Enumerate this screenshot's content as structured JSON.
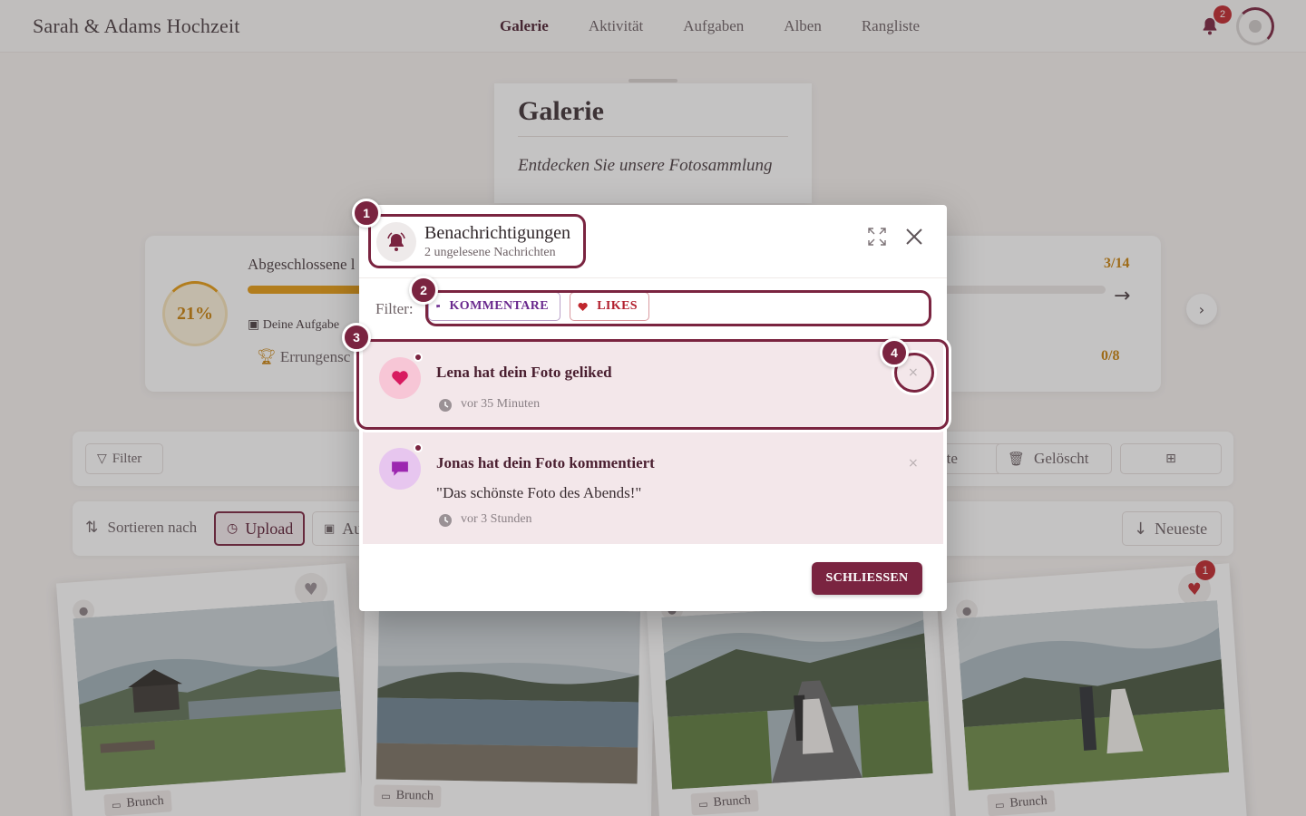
{
  "header": {
    "brand": "Sarah & Adams Hochzeit",
    "nav": [
      "Galerie",
      "Aktivität",
      "Aufgaben",
      "Alben",
      "Rangliste"
    ],
    "active_nav": "Galerie",
    "notification_count": "2"
  },
  "page": {
    "title": "Galerie",
    "subtitle": "Entdecken Sie unsere Fotosammlung"
  },
  "stats": {
    "percent": "21%",
    "progress_fraction": 0.21,
    "completed_label": "Abgeschlossene l",
    "tasks_label": "Deine Aufgabe",
    "achievements_label": "Errungensc",
    "count_tasks": "3/14",
    "count_achievements": "0/8"
  },
  "filterbar": {
    "filter_label": "Filter",
    "partial_label": "rte",
    "deleted_label": "Gelöscht"
  },
  "sortbar": {
    "sort_label": "Sortieren nach",
    "upload_label": "Upload",
    "partial_label": "Au",
    "newest_label": "Neueste"
  },
  "photos": [
    {
      "album": "Brunch",
      "liked": false
    },
    {
      "album": "Brunch",
      "liked": false
    },
    {
      "album": "Brunch",
      "liked": false
    },
    {
      "album": "Brunch",
      "liked": true,
      "like_badge": "1"
    }
  ],
  "modal": {
    "title": "Benachrichtigungen",
    "subtitle": "2 ungelesene Nachrichten",
    "filter_label": "Filter:",
    "chips": {
      "comments": "KOMMENTARE",
      "likes": "LIKES"
    },
    "notifications": [
      {
        "type": "like",
        "title": "Lena hat dein Foto geliked",
        "time": "vor 35 Minuten",
        "unread": true
      },
      {
        "type": "comment",
        "title": "Jonas hat dein Foto kommentiert",
        "quote": "\"Das schönste Foto des Abends!\"",
        "time": "vor 3 Stunden",
        "unread": true
      }
    ],
    "close_button": "SCHLIESSEN"
  },
  "tutorial_steps": [
    "1",
    "2",
    "3",
    "4"
  ],
  "colors": {
    "brand": "#7a2440",
    "accent_progress": "#e69b12",
    "badge": "#c0272d",
    "comment_chip": "#6a2a8e",
    "like_chip": "#b21f2d"
  },
  "icons": [
    "bell-icon",
    "user-avatar-icon",
    "trophy-icon",
    "image-icon",
    "arrow-right-icon",
    "chevron-right-icon",
    "filter-icon",
    "trash-icon",
    "grid-icon",
    "sort-icon",
    "clock-icon",
    "arrow-down-icon",
    "heart-icon",
    "folder-icon",
    "expand-icon",
    "close-icon",
    "comment-icon"
  ]
}
